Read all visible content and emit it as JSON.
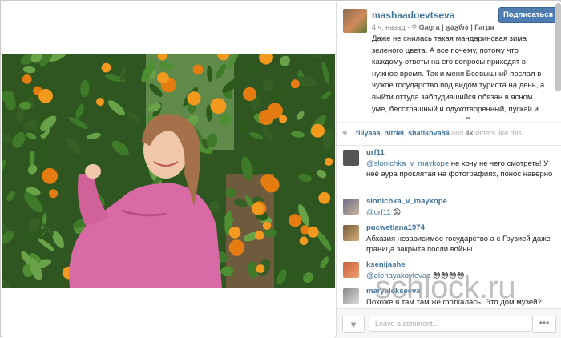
{
  "post": {
    "username": "mashaadoevtseva",
    "follow_label": "Подписаться",
    "time_ago": "4 ч. назад",
    "location": "Gagra | გაგრა | Гагра",
    "caption": "Даже не снилась такая мандариновая зима зеленого цвета. А все почему, потому что каждому ответы на его вопросы приходят в нужное время. Так и меня Всевышний послал в чужое государство под видом туриста на день, а выйти оттуда заблудившийся обязан в ясном уме, бесстрашный и одухотворенный, пускай и через три месяца ссылки. В противном случае."
  },
  "likes": {
    "users": [
      "tiliyaaa",
      "nitriel",
      "shafikova84"
    ],
    "and_label": "and",
    "count": "4k",
    "others_label": "others like this."
  },
  "comments": [
    {
      "user": "urf11",
      "mention": "@slonichka_v_maykope",
      "text": " не хочу не чего смотреть! У неё аура проклятая на фотографиях, понос наверно"
    },
    {
      "user": "slonichka_v_maykope",
      "mention": "@urf11",
      "text": " 😡"
    },
    {
      "user": "pucwetlana1974",
      "mention": "",
      "text": "Абхазия независимое государство а с Грузией даже граница закрыта посли войны"
    },
    {
      "user": "ksenijashe",
      "mention": "@elenayakovlevaa",
      "text": " 😳😳😳😳"
    },
    {
      "user": "maryalekseeva",
      "mention": "",
      "text": "Похоже я там там же фоткалась! Это дом музей?"
    }
  ],
  "footer": {
    "comment_placeholder": "Leave a comment...",
    "more_label": "•••"
  },
  "watermark": "schlock.ru",
  "colors": {
    "link": "#3f729b",
    "follow_button": "#4f7db2",
    "sweater": "#d86aa6",
    "foliage": "#3c6a2a",
    "fruit": "#f39a1e"
  }
}
